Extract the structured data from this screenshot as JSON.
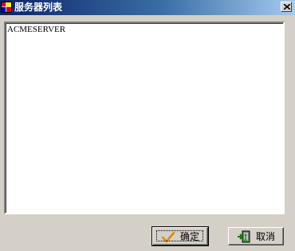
{
  "window": {
    "title": "服务器列表",
    "title_bar_colors": [
      "#0a246a",
      "#a6caf0"
    ]
  },
  "server_list": {
    "items": [
      "ACMESERVER"
    ]
  },
  "buttons": {
    "ok_label": "确定",
    "cancel_label": "取消",
    "ok_icon": "checkmark-icon",
    "cancel_icon": "exit-door-icon"
  }
}
